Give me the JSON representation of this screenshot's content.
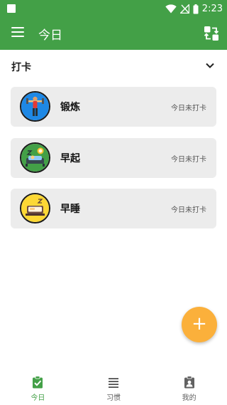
{
  "status_bar": {
    "time": "2:23"
  },
  "app_bar": {
    "title": "今日",
    "menu_icon": "menu-icon",
    "action_icon": "swap-icon"
  },
  "section": {
    "title": "打卡",
    "toggle_icon": "chevron-down-icon"
  },
  "habits": [
    {
      "name": "锻炼",
      "status": "今日未打卡",
      "icon": "exercise-icon",
      "color": "#1e88e5"
    },
    {
      "name": "早起",
      "status": "今日未打卡",
      "icon": "wake-up-icon",
      "color": "#43a047"
    },
    {
      "name": "早睡",
      "status": "今日未打卡",
      "icon": "sleep-icon",
      "color": "#fdd835"
    }
  ],
  "fab": {
    "label": "+"
  },
  "bottom_nav": [
    {
      "label": "今日",
      "icon": "clipboard-check-icon",
      "active": true
    },
    {
      "label": "习惯",
      "icon": "list-icon",
      "active": false
    },
    {
      "label": "我的",
      "icon": "profile-icon",
      "active": false
    }
  ],
  "colors": {
    "primary": "#43a047",
    "accent": "#fbb03b",
    "card": "#ececec"
  }
}
